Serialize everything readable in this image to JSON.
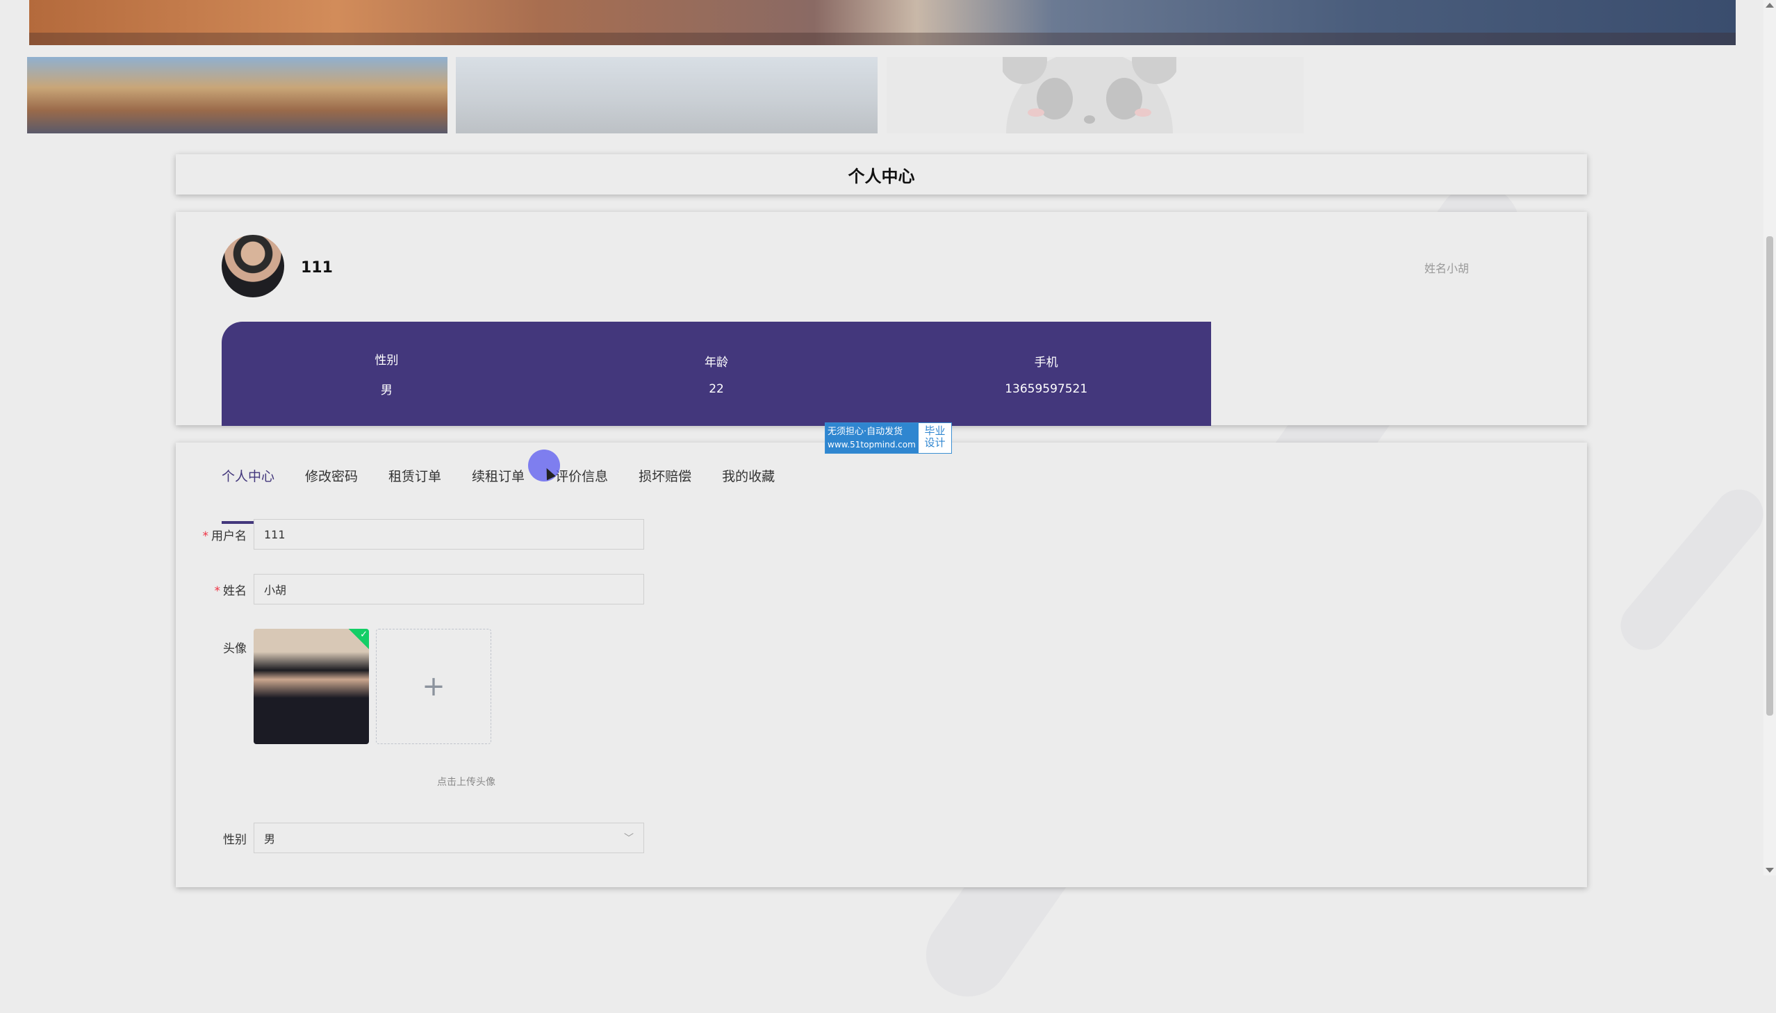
{
  "page": {
    "title": "个人中心"
  },
  "profile": {
    "username": "111",
    "hint": "姓名小胡",
    "stats": [
      {
        "label": "性别",
        "value": "男"
      },
      {
        "label": "年龄",
        "value": "22"
      },
      {
        "label": "手机",
        "value": "13659597521"
      }
    ]
  },
  "watermark": {
    "line1": "无须担心·自动发货",
    "line2": "www.51topmind.com",
    "right1": "毕业",
    "right2": "设计"
  },
  "tabs": [
    {
      "label": "个人中心"
    },
    {
      "label": "修改密码"
    },
    {
      "label": "租赁订单"
    },
    {
      "label": "续租订单"
    },
    {
      "label": "评价信息"
    },
    {
      "label": "损坏赔偿"
    },
    {
      "label": "我的收藏"
    }
  ],
  "form": {
    "username": {
      "label": "用户名",
      "value": "111"
    },
    "name": {
      "label": "姓名",
      "value": "小胡"
    },
    "avatar": {
      "label": "头像",
      "tip": "点击上传头像"
    },
    "gender": {
      "label": "性别",
      "value": "男"
    }
  },
  "colors": {
    "accent": "#43377c",
    "success": "#13ce66",
    "background": "#ececec"
  }
}
